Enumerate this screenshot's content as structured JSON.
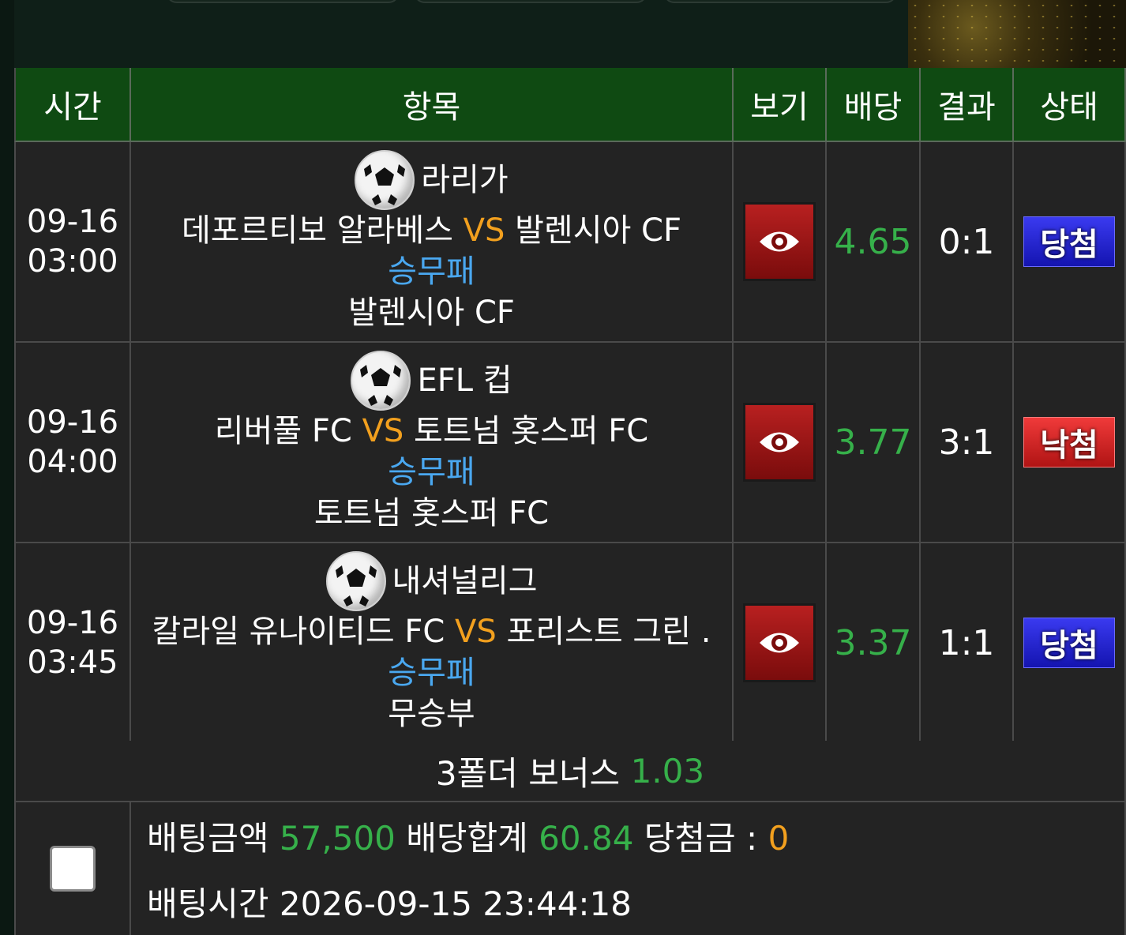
{
  "header": {
    "time": "시간",
    "item": "항목",
    "view": "보기",
    "odds": "배당",
    "result": "결과",
    "status": "상태"
  },
  "games": [
    {
      "date": "09-16",
      "time": "03:00",
      "league": "라리가",
      "home": "데포르티보 알라베스",
      "vs": "VS",
      "away": "발렌시아 CF",
      "market": "승무패",
      "pick": "발렌시아 CF",
      "odds": "4.65",
      "result": "0:1",
      "status": "당첨"
    },
    {
      "date": "09-16",
      "time": "04:00",
      "league": "EFL 컵",
      "home": "리버풀 FC",
      "vs": "VS",
      "away": "토트넘 홋스퍼 FC",
      "market": "승무패",
      "pick": "토트넘 홋스퍼 FC",
      "odds": "3.77",
      "result": "3:1",
      "status": "낙첨"
    },
    {
      "date": "09-16",
      "time": "03:45",
      "league": "내셔널리그",
      "home": "칼라일 유나이티드 FC",
      "vs": "VS",
      "away": "포리스트 그린 .",
      "market": "승무패",
      "pick": "무승부",
      "odds": "3.37",
      "result": "1:1",
      "status": "당첨"
    }
  ],
  "bonus": {
    "label": "3폴더 보너스",
    "value": "1.03"
  },
  "summary": {
    "bet_amount_label": "배팅금액",
    "bet_amount": "57,500",
    "odds_total_label": "배당합계",
    "odds_total": "60.84",
    "winnings_label": "당첨금 :",
    "winnings": "0",
    "bet_time_label": "배팅시간",
    "bet_time": "2026-09-15 23:44:18"
  },
  "colors": {
    "header_bg": "#0f4a12",
    "odds_green": "#36b04a",
    "vs_orange": "#f2a01e",
    "market_blue": "#4aa8f0",
    "win_badge": "#2020d0",
    "lose_badge": "#d02020"
  },
  "icons": {
    "league": "soccer-ball-icon",
    "view": "eye-icon"
  }
}
